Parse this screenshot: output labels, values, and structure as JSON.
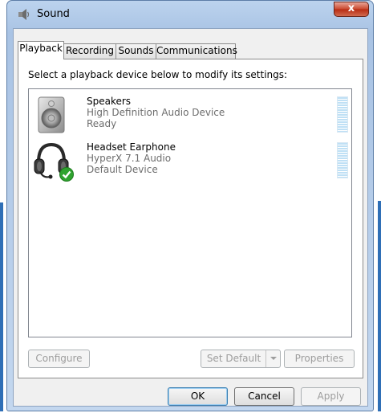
{
  "window": {
    "title": "Sound",
    "close_label": "x"
  },
  "tabs": [
    {
      "label": "Playback",
      "active": true
    },
    {
      "label": "Recording",
      "active": false
    },
    {
      "label": "Sounds",
      "active": false
    },
    {
      "label": "Communications",
      "active": false
    }
  ],
  "instruction": "Select a playback device below to modify its settings:",
  "devices": [
    {
      "name": "Speakers",
      "description": "High Definition Audio Device",
      "status": "Ready",
      "icon": "speaker-icon"
    },
    {
      "name": "Headset Earphone",
      "description": "HyperX 7.1 Audio",
      "status": "Default Device",
      "icon": "headset-icon",
      "default_badge": "green-check"
    }
  ],
  "panel_buttons": {
    "configure": "Configure",
    "set_default": "Set Default",
    "properties": "Properties"
  },
  "dialog_buttons": {
    "ok": "OK",
    "cancel": "Cancel",
    "apply": "Apply"
  },
  "colors": {
    "title_bar": "#a9c3e4",
    "close_button": "#c9472d",
    "level_meter": "#bfe0f5",
    "default_check": "#2fa32f"
  }
}
